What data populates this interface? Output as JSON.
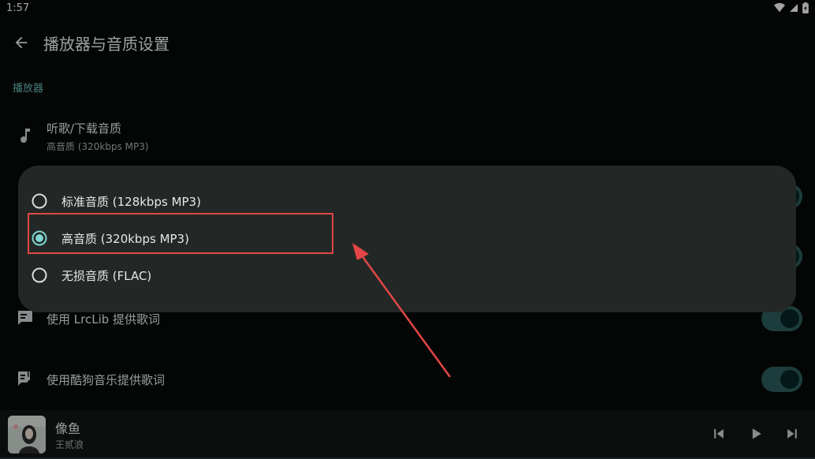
{
  "status_bar": {
    "time": "1:57",
    "icons": [
      "wifi-icon",
      "cell-signal-icon",
      "battery-icon"
    ]
  },
  "header": {
    "back_icon": "arrow-back-icon",
    "title": "播放器与音质设置"
  },
  "section": {
    "title": "播放器"
  },
  "settings": {
    "quality": {
      "icon": "music-note-icon",
      "label": "听歌/下载音质",
      "value": "高音质 (320kbps MP3)"
    },
    "lrclib": {
      "icon": "lyrics-icon",
      "label": "使用 LrcLib 提供歌词",
      "enabled": true
    },
    "kugou": {
      "icon": "lyrics-music-icon",
      "label": "使用酷狗音乐提供歌词",
      "enabled": true
    }
  },
  "dialog": {
    "options": [
      {
        "label": "标准音质 (128kbps MP3)",
        "selected": false
      },
      {
        "label": "高音质 (320kbps MP3)",
        "selected": true
      },
      {
        "label": "无损音质 (FLAC)",
        "selected": false
      }
    ]
  },
  "player": {
    "song_title": "像鱼",
    "artist": "王贰浪",
    "controls": [
      "skip-previous-icon",
      "play-icon",
      "skip-next-icon"
    ]
  },
  "colors": {
    "accent": "#7fd6d4",
    "annotation": "#e24646",
    "dialog_bg": "#232826",
    "toggle_track": "#2a5a59"
  }
}
